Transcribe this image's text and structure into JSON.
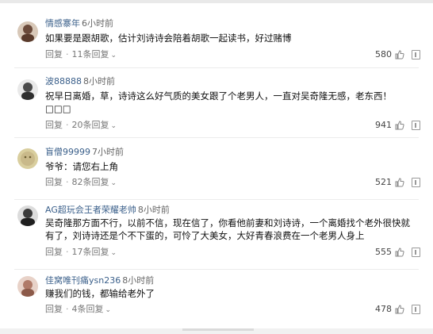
{
  "comments": [
    {
      "username": "情感寨年",
      "time": "6小时前",
      "text": "如果要是跟胡歌，估计刘诗诗会陪着胡歌一起读书，好过赌博",
      "reply_label": "回复",
      "replies_label": "11条回复",
      "likes": "580",
      "avatar_color": "#6b4a3a"
    },
    {
      "username": "波88888",
      "time": "8小时前",
      "text": "祝早日离婚，草，诗诗这么好气质的美女跟了个老男人，一直对吴奇隆无感，老东西！",
      "text2": "□□□",
      "reply_label": "回复",
      "replies_label": "20条回复",
      "likes": "941",
      "avatar_color": "#4a4a4a"
    },
    {
      "username": "盲僧99999",
      "time": "7小时前",
      "text": "爷爷：请您右上角",
      "reply_label": "回复",
      "replies_label": "82条回复",
      "likes": "521",
      "avatar_color": "#c9b98a"
    },
    {
      "username": "AG超玩会王者荣耀老帅",
      "time": "8小时前",
      "text": "吴奇隆那方面不行，以前不信，现在信了，你看他前妻和刘诗诗，一个离婚找个老外很快就有了，刘诗诗还是个不下蛋的，可怜了大美女，大好青春浪费在一个老男人身上",
      "reply_label": "回复",
      "replies_label": "17条回复",
      "likes": "555",
      "avatar_color": "#3b3b3b"
    },
    {
      "username": "佳窝唯刊痛ysn236",
      "time": "8小时前",
      "text": "赚我们的钱，都输给老外了",
      "reply_label": "回复",
      "replies_label": "4条回复",
      "likes": "478",
      "avatar_color": "#b07a68"
    }
  ],
  "colors": {
    "username": "#3a5f8a",
    "meta": "#777777"
  },
  "icons": {
    "like": "thumbs-up-icon",
    "more": "more-options-icon",
    "reply_arrow": "chevron-down-icon"
  }
}
